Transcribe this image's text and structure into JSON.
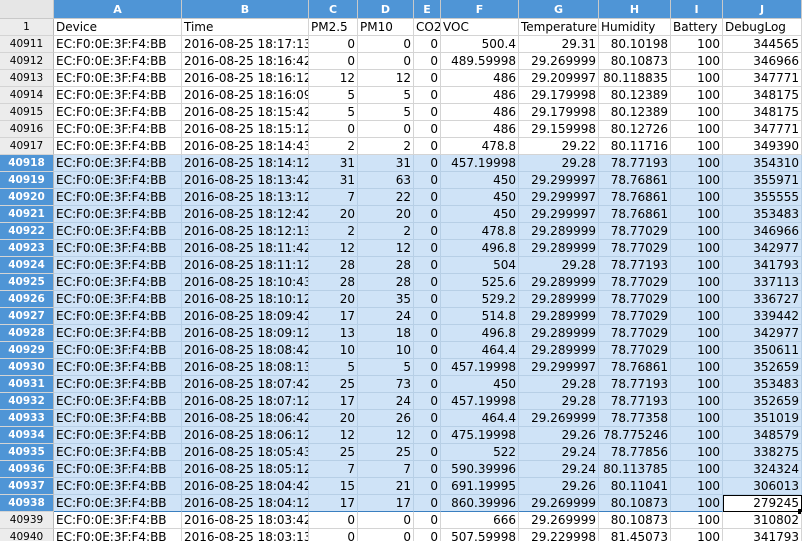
{
  "corner_label": "",
  "columns": [
    "A",
    "B",
    "C",
    "D",
    "E",
    "F",
    "G",
    "H",
    "I",
    "J"
  ],
  "table": {
    "header_row_number": "1",
    "headers": [
      "Device",
      "Time",
      "PM2.5",
      "PM10",
      "CO2",
      "VOC",
      "Temperature",
      "Humidity",
      "Battery",
      "DebugLog"
    ],
    "rows": [
      {
        "n": "40911",
        "c": [
          "EC:F0:0E:3F:F4:BB",
          "2016-08-25 18:17:13",
          "0",
          "0",
          "0",
          "500.4",
          "29.31",
          "80.10198",
          "100",
          "344565"
        ]
      },
      {
        "n": "40912",
        "c": [
          "EC:F0:0E:3F:F4:BB",
          "2016-08-25 18:16:42",
          "0",
          "0",
          "0",
          "489.59998",
          "29.269999",
          "80.10873",
          "100",
          "346966"
        ]
      },
      {
        "n": "40913",
        "c": [
          "EC:F0:0E:3F:F4:BB",
          "2016-08-25 18:16:12",
          "12",
          "12",
          "0",
          "486",
          "29.209997",
          "80.118835",
          "100",
          "347771"
        ]
      },
      {
        "n": "40914",
        "c": [
          "EC:F0:0E:3F:F4:BB",
          "2016-08-25 18:16:09",
          "5",
          "5",
          "0",
          "486",
          "29.179998",
          "80.12389",
          "100",
          "348175"
        ]
      },
      {
        "n": "40915",
        "c": [
          "EC:F0:0E:3F:F4:BB",
          "2016-08-25 18:15:42",
          "5",
          "5",
          "0",
          "486",
          "29.179998",
          "80.12389",
          "100",
          "348175"
        ]
      },
      {
        "n": "40916",
        "c": [
          "EC:F0:0E:3F:F4:BB",
          "2016-08-25 18:15:12",
          "0",
          "0",
          "0",
          "486",
          "29.159998",
          "80.12726",
          "100",
          "347771"
        ]
      },
      {
        "n": "40917",
        "c": [
          "EC:F0:0E:3F:F4:BB",
          "2016-08-25 18:14:43",
          "2",
          "2",
          "0",
          "478.8",
          "29.22",
          "80.11716",
          "100",
          "349390"
        ]
      },
      {
        "n": "40918",
        "c": [
          "EC:F0:0E:3F:F4:BB",
          "2016-08-25 18:14:12",
          "31",
          "31",
          "0",
          "457.19998",
          "29.28",
          "78.77193",
          "100",
          "354310"
        ]
      },
      {
        "n": "40919",
        "c": [
          "EC:F0:0E:3F:F4:BB",
          "2016-08-25 18:13:42",
          "31",
          "63",
          "0",
          "450",
          "29.299997",
          "78.76861",
          "100",
          "355971"
        ]
      },
      {
        "n": "40920",
        "c": [
          "EC:F0:0E:3F:F4:BB",
          "2016-08-25 18:13:12",
          "7",
          "22",
          "0",
          "450",
          "29.299997",
          "78.76861",
          "100",
          "355555"
        ]
      },
      {
        "n": "40921",
        "c": [
          "EC:F0:0E:3F:F4:BB",
          "2016-08-25 18:12:42",
          "20",
          "20",
          "0",
          "450",
          "29.299997",
          "78.76861",
          "100",
          "353483"
        ]
      },
      {
        "n": "40922",
        "c": [
          "EC:F0:0E:3F:F4:BB",
          "2016-08-25 18:12:13",
          "2",
          "2",
          "0",
          "478.8",
          "29.289999",
          "78.77029",
          "100",
          "346966"
        ]
      },
      {
        "n": "40923",
        "c": [
          "EC:F0:0E:3F:F4:BB",
          "2016-08-25 18:11:42",
          "12",
          "12",
          "0",
          "496.8",
          "29.289999",
          "78.77029",
          "100",
          "342977"
        ]
      },
      {
        "n": "40924",
        "c": [
          "EC:F0:0E:3F:F4:BB",
          "2016-08-25 18:11:12",
          "28",
          "28",
          "0",
          "504",
          "29.28",
          "78.77193",
          "100",
          "341793"
        ]
      },
      {
        "n": "40925",
        "c": [
          "EC:F0:0E:3F:F4:BB",
          "2016-08-25 18:10:43",
          "28",
          "28",
          "0",
          "525.6",
          "29.289999",
          "78.77029",
          "100",
          "337113"
        ]
      },
      {
        "n": "40926",
        "c": [
          "EC:F0:0E:3F:F4:BB",
          "2016-08-25 18:10:12",
          "20",
          "35",
          "0",
          "529.2",
          "29.289999",
          "78.77029",
          "100",
          "336727"
        ]
      },
      {
        "n": "40927",
        "c": [
          "EC:F0:0E:3F:F4:BB",
          "2016-08-25 18:09:42",
          "17",
          "24",
          "0",
          "514.8",
          "29.289999",
          "78.77029",
          "100",
          "339442"
        ]
      },
      {
        "n": "40928",
        "c": [
          "EC:F0:0E:3F:F4:BB",
          "2016-08-25 18:09:12",
          "13",
          "18",
          "0",
          "496.8",
          "29.289999",
          "78.77029",
          "100",
          "342977"
        ]
      },
      {
        "n": "40929",
        "c": [
          "EC:F0:0E:3F:F4:BB",
          "2016-08-25 18:08:42",
          "10",
          "10",
          "0",
          "464.4",
          "29.289999",
          "78.77029",
          "100",
          "350611"
        ]
      },
      {
        "n": "40930",
        "c": [
          "EC:F0:0E:3F:F4:BB",
          "2016-08-25 18:08:13",
          "5",
          "5",
          "0",
          "457.19998",
          "29.299997",
          "78.76861",
          "100",
          "352659"
        ]
      },
      {
        "n": "40931",
        "c": [
          "EC:F0:0E:3F:F4:BB",
          "2016-08-25 18:07:42",
          "25",
          "73",
          "0",
          "450",
          "29.28",
          "78.77193",
          "100",
          "353483"
        ]
      },
      {
        "n": "40932",
        "c": [
          "EC:F0:0E:3F:F4:BB",
          "2016-08-25 18:07:12",
          "17",
          "24",
          "0",
          "457.19998",
          "29.28",
          "78.77193",
          "100",
          "352659"
        ]
      },
      {
        "n": "40933",
        "c": [
          "EC:F0:0E:3F:F4:BB",
          "2016-08-25 18:06:42",
          "20",
          "26",
          "0",
          "464.4",
          "29.269999",
          "78.77358",
          "100",
          "351019"
        ]
      },
      {
        "n": "40934",
        "c": [
          "EC:F0:0E:3F:F4:BB",
          "2016-08-25 18:06:12",
          "12",
          "12",
          "0",
          "475.19998",
          "29.26",
          "78.775246",
          "100",
          "348579"
        ]
      },
      {
        "n": "40935",
        "c": [
          "EC:F0:0E:3F:F4:BB",
          "2016-08-25 18:05:43",
          "25",
          "25",
          "0",
          "522",
          "29.24",
          "78.77856",
          "100",
          "338275"
        ]
      },
      {
        "n": "40936",
        "c": [
          "EC:F0:0E:3F:F4:BB",
          "2016-08-25 18:05:12",
          "7",
          "7",
          "0",
          "590.39996",
          "29.24",
          "80.113785",
          "100",
          "324324"
        ]
      },
      {
        "n": "40937",
        "c": [
          "EC:F0:0E:3F:F4:BB",
          "2016-08-25 18:04:42",
          "15",
          "21",
          "0",
          "691.19995",
          "29.26",
          "80.11041",
          "100",
          "306013"
        ]
      },
      {
        "n": "40938",
        "c": [
          "EC:F0:0E:3F:F4:BB",
          "2016-08-25 18:04:12",
          "17",
          "17",
          "0",
          "860.39996",
          "29.269999",
          "80.10873",
          "100",
          "279245"
        ]
      },
      {
        "n": "40939",
        "c": [
          "EC:F0:0E:3F:F4:BB",
          "2016-08-25 18:03:42",
          "0",
          "0",
          "0",
          "666",
          "29.269999",
          "80.10873",
          "100",
          "310802"
        ]
      },
      {
        "n": "40940",
        "c": [
          "EC:F0:0E:3F:F4:BB",
          "2016-08-25 18:03:13",
          "0",
          "0",
          "0",
          "507.59998",
          "29.229998",
          "81.45073",
          "100",
          "341793"
        ]
      }
    ]
  },
  "selection": {
    "first_row": "40918",
    "last_row": "40938",
    "cursor_cell": "J40938"
  },
  "colors": {
    "selection_header": "#4f95d6",
    "selection_fill": "#cfe3f7",
    "grid": "#d4d4d4"
  }
}
